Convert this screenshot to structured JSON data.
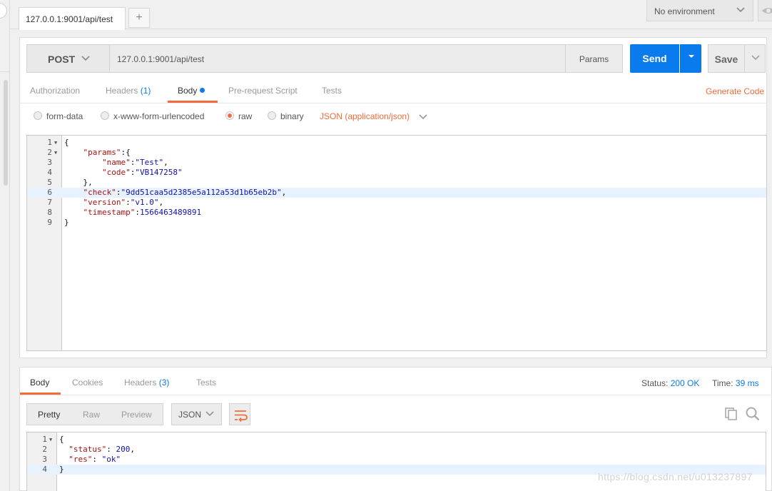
{
  "tabbar": {
    "active_tab": "127.0.0.1:9001/api/test",
    "add_tab": "+",
    "environment": "No environment"
  },
  "request": {
    "method": "POST",
    "url": "127.0.0.1:9001/api/test",
    "params_label": "Params",
    "send_label": "Send",
    "save_label": "Save",
    "tabs": {
      "authorization": "Authorization",
      "headers": "Headers",
      "headers_count": "(1)",
      "body": "Body",
      "pre_request": "Pre-request Script",
      "tests": "Tests"
    },
    "generate_code": "Generate Code",
    "body_modes": {
      "form_data": "form-data",
      "urlencoded": "x-www-form-urlencoded",
      "raw": "raw",
      "binary": "binary"
    },
    "selected_mode": "raw",
    "content_type": "JSON (application/json)",
    "body_lines": [
      {
        "n": "1",
        "fold": true,
        "parts": [
          [
            "p",
            "{"
          ]
        ]
      },
      {
        "n": "2",
        "fold": true,
        "parts": [
          [
            "p",
            "    "
          ],
          [
            "k",
            "\"params\""
          ],
          [
            "p",
            ":{"
          ]
        ]
      },
      {
        "n": "3",
        "fold": false,
        "parts": [
          [
            "p",
            "        "
          ],
          [
            "k",
            "\"name\""
          ],
          [
            "p",
            ":"
          ],
          [
            "s",
            "\"Test\""
          ],
          [
            "p",
            ","
          ]
        ]
      },
      {
        "n": "4",
        "fold": false,
        "parts": [
          [
            "p",
            "        "
          ],
          [
            "k",
            "\"code\""
          ],
          [
            "p",
            ":"
          ],
          [
            "s",
            "\"VB147258\""
          ]
        ]
      },
      {
        "n": "5",
        "fold": false,
        "parts": [
          [
            "p",
            "    },"
          ]
        ]
      },
      {
        "n": "6",
        "fold": false,
        "hl": true,
        "parts": [
          [
            "p",
            "    "
          ],
          [
            "k",
            "\"check\""
          ],
          [
            "p",
            ":"
          ],
          [
            "s",
            "\"9dd51caa5d2385e5a112a53d1b65eb2b\""
          ],
          [
            "p",
            ","
          ]
        ]
      },
      {
        "n": "7",
        "fold": false,
        "parts": [
          [
            "p",
            "    "
          ],
          [
            "k",
            "\"version\""
          ],
          [
            "p",
            ":"
          ],
          [
            "s",
            "\"v1.0\""
          ],
          [
            "p",
            ","
          ]
        ]
      },
      {
        "n": "8",
        "fold": false,
        "parts": [
          [
            "p",
            "    "
          ],
          [
            "k",
            "\"timestamp\""
          ],
          [
            "p",
            ":"
          ],
          [
            "n",
            "1566463489891"
          ]
        ]
      },
      {
        "n": "9",
        "fold": false,
        "parts": [
          [
            "p",
            "}"
          ]
        ]
      }
    ]
  },
  "response": {
    "tabs": {
      "body": "Body",
      "cookies": "Cookies",
      "headers": "Headers",
      "headers_count": "(3)",
      "tests": "Tests"
    },
    "status_label": "Status:",
    "status_value": "200 OK",
    "time_label": "Time:",
    "time_value": "39 ms",
    "view_modes": {
      "pretty": "Pretty",
      "raw": "Raw",
      "preview": "Preview"
    },
    "format": "JSON",
    "body_lines": [
      {
        "n": "1",
        "fold": true,
        "parts": [
          [
            "p",
            "{"
          ]
        ]
      },
      {
        "n": "2",
        "fold": false,
        "parts": [
          [
            "p",
            "  "
          ],
          [
            "k",
            "\"status\""
          ],
          [
            "p",
            ": "
          ],
          [
            "n",
            "200"
          ],
          [
            "p",
            ","
          ]
        ]
      },
      {
        "n": "3",
        "fold": false,
        "parts": [
          [
            "p",
            "  "
          ],
          [
            "k",
            "\"res\""
          ],
          [
            "p",
            ": "
          ],
          [
            "s",
            "\"ok\""
          ]
        ]
      },
      {
        "n": "4",
        "fold": false,
        "hl": true,
        "parts": [
          [
            "p",
            "}"
          ]
        ]
      }
    ]
  },
  "watermark": "https://blog.csdn.net/u013237897",
  "colors": {
    "accent": "#f26b3a",
    "primary": "#097bed"
  },
  "icons": [
    "chevron-down-icon",
    "eye-icon",
    "wrap-icon",
    "copy-icon",
    "search-icon"
  ]
}
